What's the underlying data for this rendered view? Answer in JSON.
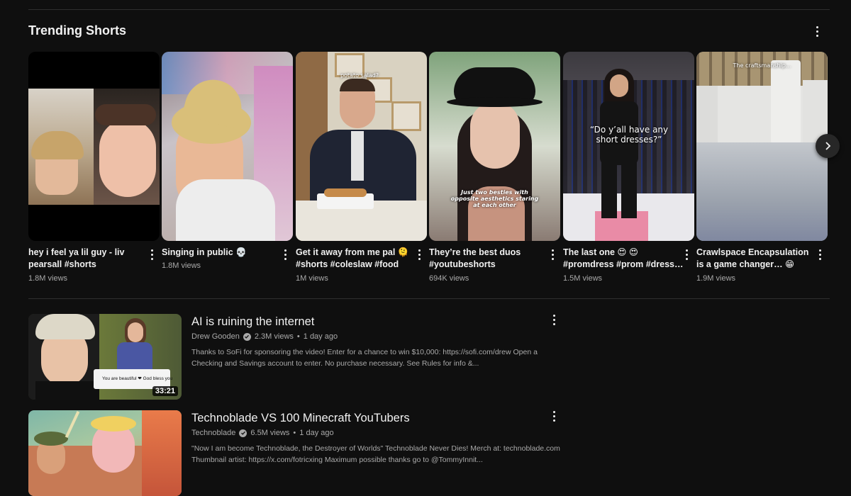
{
  "shelf": {
    "title": "Trending Shorts"
  },
  "shorts": [
    {
      "title": "hey i feel ya lil guy - liv pearsall #shorts",
      "views": "1.8M views",
      "overlay": ""
    },
    {
      "title": "Singing in public 💀",
      "views": "1.8M views",
      "overlay": ""
    },
    {
      "title": "Get it away from me pal 🫠 #shorts #coleslaw #food",
      "views": "1M views",
      "overlay": "potato salad?"
    },
    {
      "title": "They’re the best duos #youtubeshorts",
      "views": "694K views",
      "overlay": "Just two besties with opposite aesthetics staring at each other"
    },
    {
      "title": "The last one 😍 😍 #promdress #prom #dress…",
      "views": "1.5M views",
      "overlay": "“Do y’all have any short dresses?”"
    },
    {
      "title": "Crawlspace Encapsulation is a game changer… 😁",
      "views": "1.9M views",
      "overlay": "The craftsmanship..."
    }
  ],
  "videos": [
    {
      "title": "AI is ruining the internet",
      "channel": "Drew Gooden",
      "views": "2.3M views",
      "age": "1 day ago",
      "description": "Thanks to SoFi for sponsoring the video! Enter for a chance to win $10,000: https://sofi.com/drew Open a Checking and Savings account to enter. No purchase necessary. See Rules for info &...",
      "duration": "33:21",
      "comment_text": "You are beautiful ❤ God bless you"
    },
    {
      "title": "Technoblade VS 100 Minecraft YouTubers",
      "channel": "Technoblade",
      "views": "6.5M views",
      "age": "1 day ago",
      "description": "\"Now I am become Technoblade, the Destroyer of Worlds\" Technoblade Never Dies! Merch at: technoblade.com Thumbnail artist: https://x.com/fotricxing Maximum possible thanks go to @TommyInnit...",
      "duration": ""
    }
  ],
  "colors": {
    "background": "#0f0f0f",
    "text_primary": "#f1f1f1",
    "text_secondary": "#aaaaaa"
  }
}
